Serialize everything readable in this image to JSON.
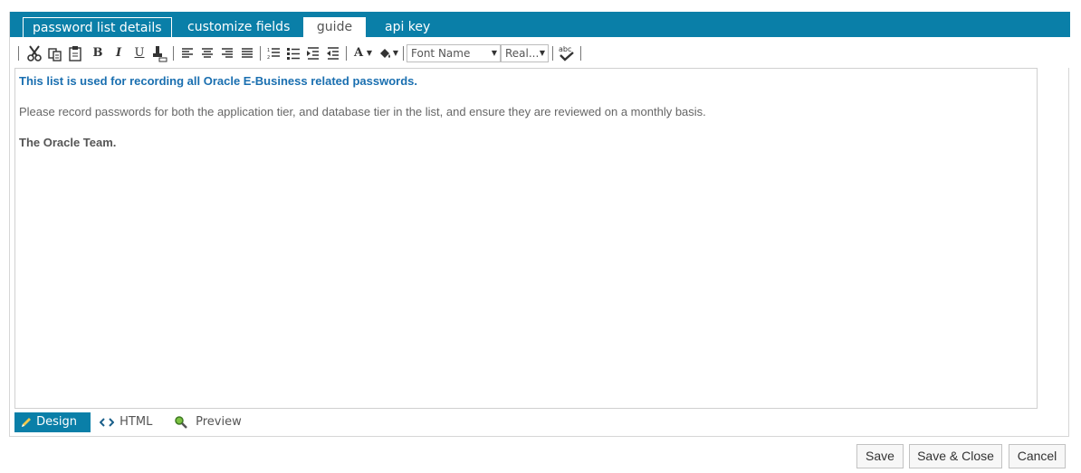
{
  "tabs": [
    {
      "label": "password list details"
    },
    {
      "label": "customize fields"
    },
    {
      "label": "guide"
    },
    {
      "label": "api key"
    }
  ],
  "toolbar": {
    "bold": "B",
    "italic": "I",
    "underline": "U",
    "font_color": "A",
    "font_name": "Font Name",
    "font_size": "Real...",
    "spellcheck": "abc"
  },
  "editor": {
    "line1": "This list is used for recording all Oracle E-Business related passwords.",
    "line2": "Please record passwords for both the application tier, and database tier in the list, and ensure they are reviewed on a monthly basis.",
    "line3": "The Oracle Team."
  },
  "modes": {
    "design": "Design",
    "html": "HTML",
    "preview": "Preview"
  },
  "buttons": {
    "save": "Save",
    "save_close": "Save & Close",
    "cancel": "Cancel"
  },
  "colors": {
    "accent": "#0a7fa8",
    "heading_text": "#1a6fb0"
  }
}
